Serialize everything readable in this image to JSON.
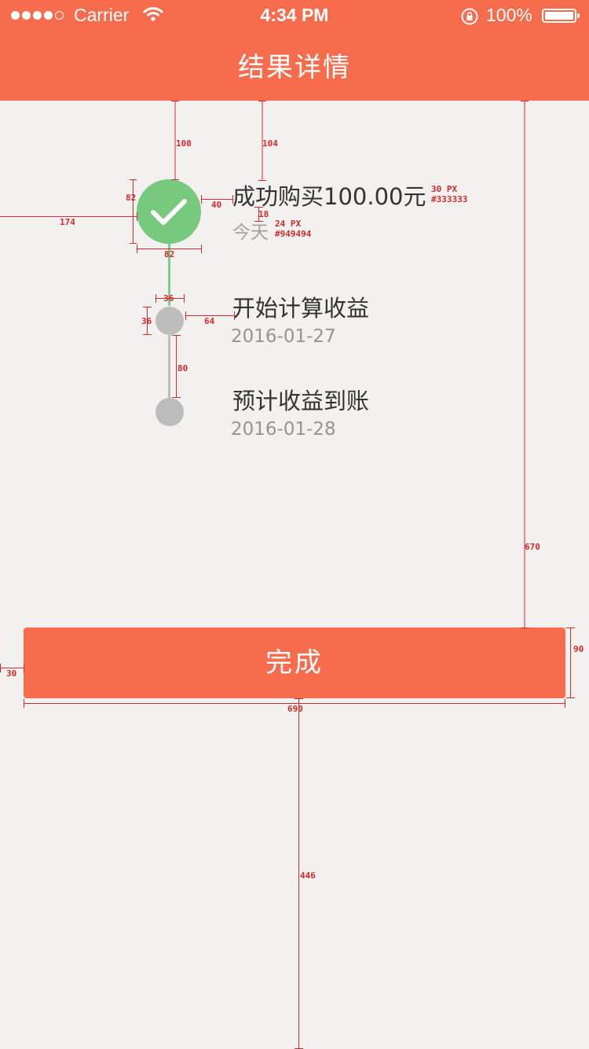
{
  "status_bar": {
    "carrier": "Carrier",
    "time": "4:34 PM",
    "battery": "100%"
  },
  "header": {
    "title": "结果详情",
    "background_color": "#f76c4d"
  },
  "timeline": {
    "steps": [
      {
        "title": "成功购买100.00元",
        "date": "今天",
        "status": "done",
        "icon": "check-icon"
      },
      {
        "title": "开始计算收益",
        "date": "2016-01-27",
        "status": "pending"
      },
      {
        "title": "预计收益到账",
        "date": "2016-01-28",
        "status": "pending"
      }
    ]
  },
  "annotations": {
    "gap_top_icon": "100",
    "gap_top_text": "104",
    "icon_height": "82",
    "icon_width": "82",
    "left_offset": "174",
    "icon_text_gap": "40",
    "title_date_gap": "18",
    "title_font": "30 PX",
    "title_color": "#333333",
    "date_font": "24 PX",
    "date_color": "#949494",
    "node_width": "36",
    "node_height": "36",
    "node_text_gap": "64",
    "connector_length": "80",
    "button_gap_top": "670",
    "button_height": "90",
    "button_margin": "30",
    "button_width": "690",
    "button_gap_bottom": "446"
  },
  "footer": {
    "done_label": "完成"
  },
  "colors": {
    "accent": "#f76c4d",
    "success": "#77c97e",
    "pending": "#bcbcbc",
    "background": "#f2f1ef",
    "annotation": "#d22a2a"
  }
}
